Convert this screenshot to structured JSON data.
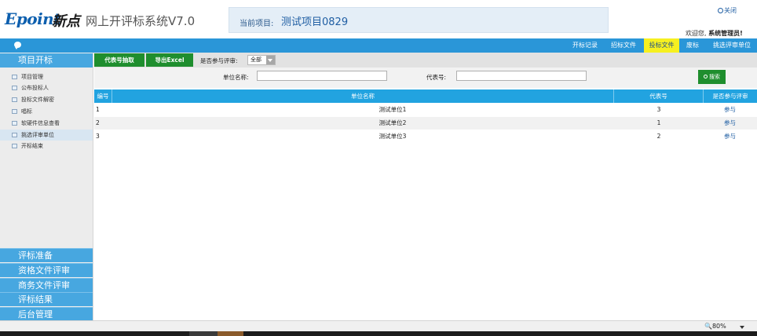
{
  "header": {
    "logo_en": "Epoint",
    "logo_cn": "新点",
    "app_title": "网上开评标系统V7.0",
    "project_label": "当前项目:",
    "project_name": "测试项目0829",
    "close_label": "关闭",
    "welcome_text": "欢迎您,",
    "user_name": "系统管理员!"
  },
  "topnav": {
    "items": [
      "开标记录",
      "招标文件",
      "投标文件",
      "废标",
      "挑选评审单位"
    ],
    "active": "投标文件",
    "active_color": "#f6f020"
  },
  "sidebar": {
    "header": "项目开标",
    "items": [
      "项目管理",
      "公布投标人",
      "投标文件解密",
      "唱标",
      "软硬件信息查看",
      "挑选评审单位",
      "开标结束"
    ],
    "active_item": "挑选评审单位",
    "sections": [
      "评标准备",
      "资格文件评审",
      "商务文件评审",
      "评标结果",
      "后台管理"
    ]
  },
  "toolbar": {
    "btn_draw": "代表号抽取",
    "btn_export": "导出Excel",
    "filter_label": "是否参与评审:",
    "filter_value": "全部"
  },
  "search": {
    "unit_label": "单位名称:",
    "unit_value": "",
    "code_label": "代表号:",
    "code_value": "",
    "button": "搜索"
  },
  "table": {
    "columns": [
      "编号",
      "单位名称",
      "代表号",
      "是否参与评审"
    ],
    "rows": [
      {
        "no": "1",
        "name": "测试单位1",
        "code": "3",
        "action": "参与"
      },
      {
        "no": "2",
        "name": "测试单位2",
        "code": "1",
        "action": "参与"
      },
      {
        "no": "3",
        "name": "测试单位3",
        "code": "2",
        "action": "参与"
      }
    ]
  },
  "status": {
    "zoom": "80%"
  },
  "colors": {
    "brand_blue": "#2a96d8",
    "button_green": "#1f8e2e",
    "table_header": "#22a3e0"
  }
}
